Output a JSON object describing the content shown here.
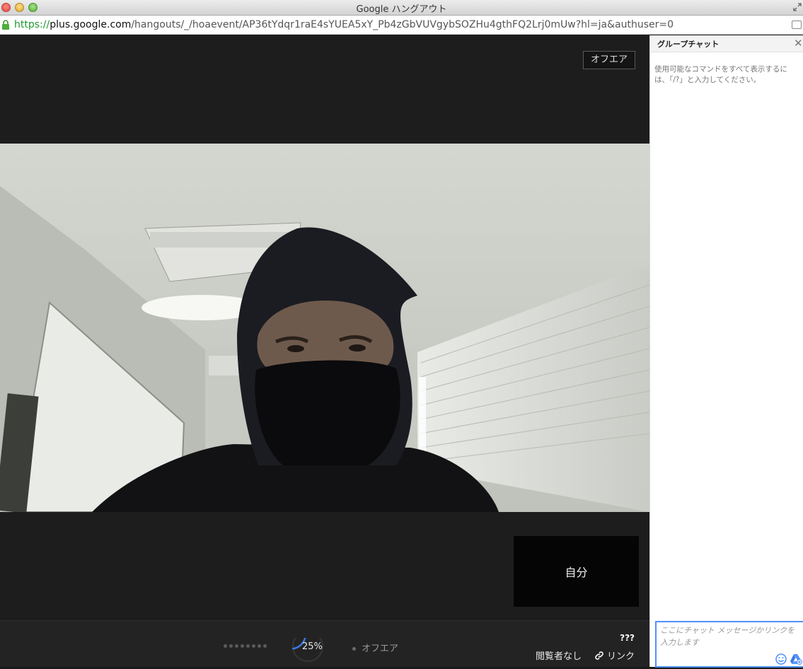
{
  "window": {
    "title": "Google ハングアウト"
  },
  "urlbar": {
    "scheme": "https://",
    "host": "plus.google.com",
    "path": "/hangouts/_/hoaevent/AP36tYdqr1raE4sYUEA5xY_Pb4zGbVUVgybSOZHu4gthFQ2Lrj0mUw?hl=ja&authuser=0"
  },
  "stage": {
    "offair_badge": "オフエア",
    "self_tile_label": "自分"
  },
  "controls": {
    "progress_label": "25%",
    "progress_value": 0.25,
    "status_label": "オフエア",
    "viewer_count": "???",
    "viewers_label": "閲覧者なし",
    "link_label": "リンク"
  },
  "chat": {
    "title": "グループチャット",
    "hint_line1": "使用可能なコマンドをすべて表示するに",
    "hint_line2": "は、「/?」と入力してください。",
    "input_placeholder": "ここにチャット メッセージかリンクを入力します"
  },
  "colors": {
    "accent": "#4d90fe",
    "secure": "#1e9a2e"
  }
}
